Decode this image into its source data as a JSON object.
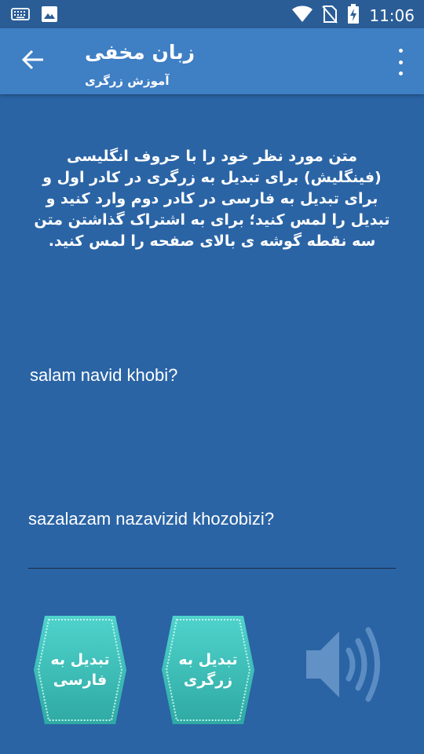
{
  "status_bar": {
    "time": "11:06",
    "left_icons": [
      "keyboard-icon",
      "image-icon"
    ],
    "right_icons": [
      "wifi-icon",
      "no-sim-icon",
      "battery-charging-icon"
    ]
  },
  "app_bar": {
    "title": "زبان مخفی",
    "subtitle": "آموزش زرگری",
    "back_icon": "arrow-left-icon",
    "menu_icon": "more-vert-icon"
  },
  "instructions": "متن مورد نظر خود را با حروف انگلیسی (فینگلیش) برای تبدیل به زرگری در کادر اول و برای تبدیل به فارسی در کادر دوم وارد کنید و تبدیل را لمس کنید؛ برای به اشتراک گذاشتن متن سه نقطه گوشه ی بالای صفحه را لمس کنید.",
  "input_text": "salam navid khobi?",
  "output_text": "sazalazam nazavizid khozobizi?",
  "buttons": {
    "to_persian": "تبدیل به\nفارسی",
    "to_zargari": "تبدیل به\nزرگری",
    "speak_icon": "speaker-icon"
  },
  "colors": {
    "background": "#2a64a5",
    "app_bar": "#3f7fc4",
    "status_bar": "#2a5d96",
    "button_fill": "#3bbfb8"
  }
}
